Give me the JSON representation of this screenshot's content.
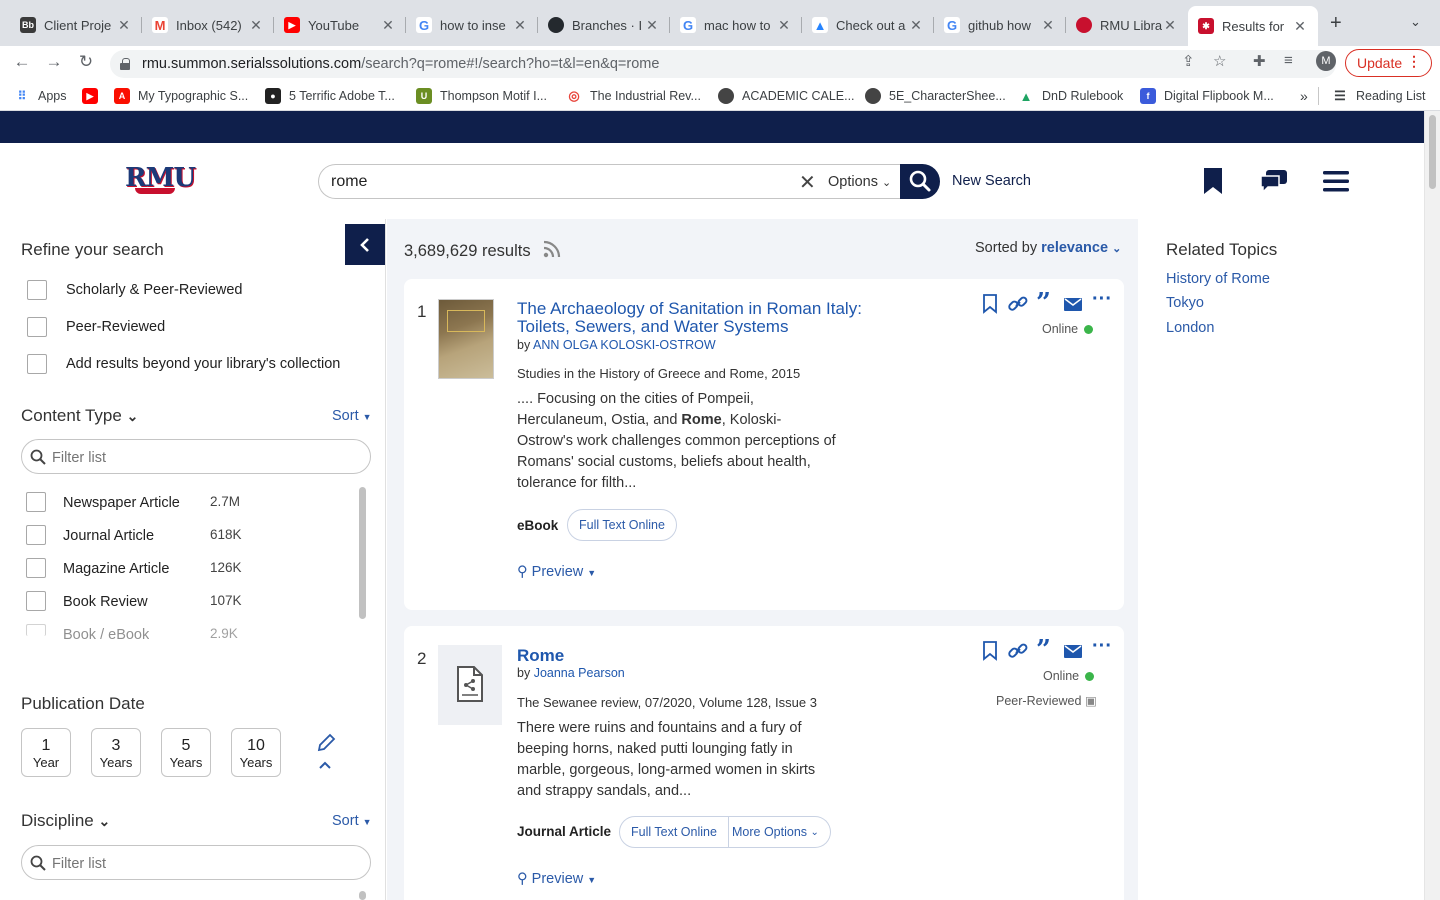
{
  "browser": {
    "tabs": [
      {
        "title": "Client Proje",
        "favicon": "blackboard-icon",
        "color": "#3a3a3a"
      },
      {
        "title": "Inbox (542)",
        "favicon": "gmail-icon",
        "color": "#ea4335"
      },
      {
        "title": "YouTube",
        "favicon": "youtube-icon",
        "color": "#ff0000"
      },
      {
        "title": "how to inse",
        "favicon": "google-icon",
        "color": "#4285f4"
      },
      {
        "title": "Branches · I",
        "favicon": "github-icon",
        "color": "#24292e"
      },
      {
        "title": "mac how to",
        "favicon": "google-icon",
        "color": "#4285f4"
      },
      {
        "title": "Check out a",
        "favicon": "atlassian-icon",
        "color": "#2684ff"
      },
      {
        "title": "github how",
        "favicon": "google-icon",
        "color": "#4285f4"
      },
      {
        "title": "RMU Library",
        "favicon": "rmu-icon",
        "color": "#c8102e"
      },
      {
        "title": "Results for",
        "favicon": "summon-icon",
        "color": "#c8102e"
      }
    ],
    "url_host": "rmu.summon.serialssolutions.com",
    "url_path": "/search?q=rome#!/search?ho=t&l=en&q=rome",
    "avatar_letter": "M",
    "update_label": "Update",
    "bookmarks": [
      {
        "label": "Apps",
        "icon": "apps-grid-icon",
        "color": "#4285f4"
      },
      {
        "label": "",
        "icon": "youtube-icon",
        "color": "#ff0000"
      },
      {
        "label": "My Typographic S...",
        "icon": "adobe-icon",
        "color": "#fa0f00"
      },
      {
        "label": "5 Terrific Adobe T...",
        "icon": "site-icon",
        "color": "#222222"
      },
      {
        "label": "Thompson Motif I...",
        "icon": "uj-icon",
        "color": "#6b8e23"
      },
      {
        "label": "The Industrial Rev...",
        "icon": "target-icon",
        "color": "#e8453c"
      },
      {
        "label": "ACADEMIC CALE...",
        "icon": "globe-icon",
        "color": "#444444"
      },
      {
        "label": "5E_CharacterShee...",
        "icon": "globe-icon",
        "color": "#444444"
      },
      {
        "label": "DnD Rulebook",
        "icon": "google-drive-icon",
        "color": "#1fa463"
      },
      {
        "label": "Digital Flipbook M...",
        "icon": "flipbook-icon",
        "color": "#3b5bdb"
      }
    ],
    "bookmarks_overflow": "»",
    "reading_list": "Reading List"
  },
  "header": {
    "logo_text": "RMU",
    "search_query": "rome",
    "options_label": "Options",
    "new_search_label": "New Search"
  },
  "refine": {
    "title": "Refine your search",
    "checkboxes": [
      "Scholarly & Peer-Reviewed",
      "Peer-Reviewed",
      "Add results beyond your library's collection"
    ],
    "content_type": {
      "title": "Content Type",
      "sort_label": "Sort",
      "filter_placeholder": "Filter list",
      "items": [
        {
          "label": "Newspaper Article",
          "count": "2.7M"
        },
        {
          "label": "Journal Article",
          "count": "618K"
        },
        {
          "label": "Magazine Article",
          "count": "126K"
        },
        {
          "label": "Book Review",
          "count": "107K"
        },
        {
          "label": "Book / eBook",
          "count": "2.9K"
        }
      ]
    },
    "publication_date": {
      "title": "Publication Date",
      "options": [
        {
          "n": "1",
          "unit": "Year"
        },
        {
          "n": "3",
          "unit": "Years"
        },
        {
          "n": "5",
          "unit": "Years"
        },
        {
          "n": "10",
          "unit": "Years"
        }
      ]
    },
    "discipline": {
      "title": "Discipline",
      "sort_label": "Sort",
      "filter_placeholder": "Filter list"
    }
  },
  "results": {
    "count_label": "3,689,629 results",
    "sorted_by_label": "Sorted by",
    "sorted_by_value": "relevance",
    "items": [
      {
        "num": "1",
        "title_line1": "The Archaeology of Sanitation in Roman Italy:",
        "title_line2": "Toilets, Sewers, and Water Systems",
        "by": "by",
        "author": "ANN OLGA KOLOSKI-OSTROW",
        "source": "Studies in the History of Greece and Rome, 2015",
        "snippet_pre": ".... Focusing on the cities of Pompeii, Herculaneum, Ostia, and ",
        "snippet_bold": "Rome",
        "snippet_post": ", Koloski-Ostrow's work challenges common perceptions of Romans' social customs, beliefs about health, tolerance for filth...",
        "type": "eBook",
        "fulltext": "Full Text Online",
        "preview": "Preview",
        "status": "Online"
      },
      {
        "num": "2",
        "title_line1": "Rome",
        "by": "by",
        "author": "Joanna Pearson",
        "source": "The Sewanee review, 07/2020, Volume 128, Issue 3",
        "snippet": "There were ruins and fountains and a fury of beeping horns, naked putti lounging fatly in marble, gorgeous, long-armed women in skirts and strappy sandals, and...",
        "type": "Journal Article",
        "fulltext": "Full Text Online",
        "more_options": "More Options",
        "preview": "Preview",
        "status": "Online",
        "peer_reviewed": "Peer-Reviewed"
      }
    ]
  },
  "related": {
    "title": "Related Topics",
    "links": [
      "History of Rome",
      "Tokyo",
      "London"
    ]
  },
  "colors": {
    "navy": "#0f1f4b",
    "link": "#2b5aa8",
    "online": "#3bb54a"
  }
}
